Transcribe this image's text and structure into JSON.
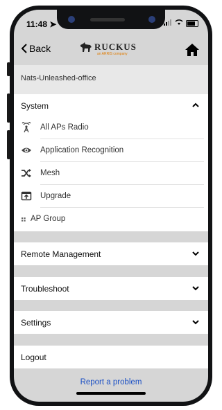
{
  "status_bar": {
    "time": "11:48 ➤"
  },
  "navbar": {
    "back_label": "Back",
    "logo_text": "RUCKUS",
    "logo_tagline": "an ARRIS company"
  },
  "site": {
    "name": "Nats-Unleashed-office"
  },
  "system": {
    "label": "System",
    "items": [
      {
        "icon": "wifi-antenna-icon",
        "label": "All APs Radio"
      },
      {
        "icon": "eye-icon",
        "label": "Application Recognition"
      },
      {
        "icon": "shuffle-icon",
        "label": "Mesh"
      },
      {
        "icon": "upgrade-icon",
        "label": "Upgrade"
      },
      {
        "icon": "grid-icon",
        "label": "AP Group"
      }
    ]
  },
  "remote_management": {
    "label": "Remote Management"
  },
  "troubleshoot": {
    "label": "Troubleshoot"
  },
  "settings": {
    "label": "Settings"
  },
  "logout": {
    "label": "Logout"
  },
  "report": {
    "label": "Report a problem"
  },
  "colors": {
    "background": "#d6d6d6",
    "link": "#1a4fc4",
    "brand_accent": "#e07b00"
  }
}
